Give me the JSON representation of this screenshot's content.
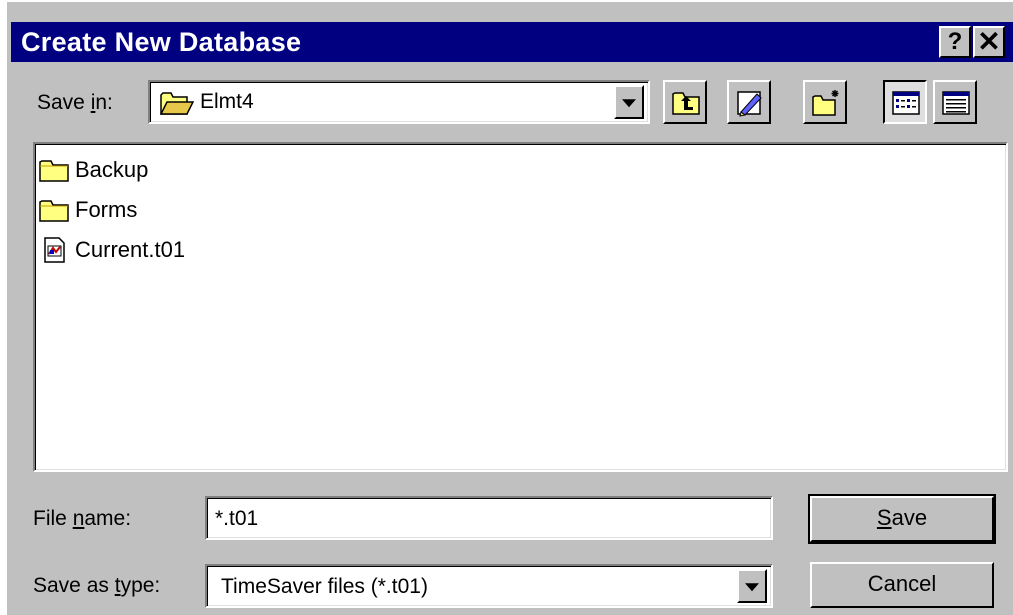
{
  "window": {
    "title": "Create New Database",
    "help_glyph": "?",
    "close_glyph": "✕"
  },
  "save_in": {
    "label_pre": "Save ",
    "label_accel": "i",
    "label_post": "n:",
    "value": "Elmt4"
  },
  "toolbar": {
    "icons": [
      "up-one-level-icon",
      "favorites-icon",
      "new-folder-icon",
      "list-view-icon",
      "details-view-icon"
    ]
  },
  "files": [
    {
      "name": "Backup",
      "icon": "folder-icon"
    },
    {
      "name": "Forms",
      "icon": "folder-icon"
    },
    {
      "name": "Current.t01",
      "icon": "timesaver-file-icon"
    }
  ],
  "file_name": {
    "label_pre": "File ",
    "label_accel": "n",
    "label_post": "ame:",
    "value": "*.t01"
  },
  "save_type": {
    "label_pre": "Save as ",
    "label_accel": "t",
    "label_post": "ype:",
    "value": "TimeSaver files (*.t01)"
  },
  "buttons": {
    "save_accel": "S",
    "save_rest": "ave",
    "cancel": "Cancel"
  },
  "colors": {
    "titlebar": "#000080",
    "face": "#c0c0c0",
    "window": "#ffffff"
  }
}
